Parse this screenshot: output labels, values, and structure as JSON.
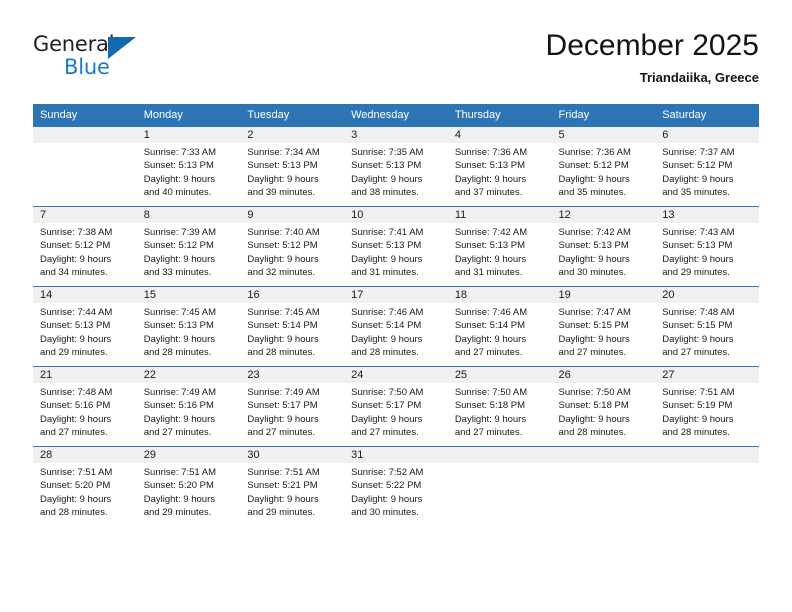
{
  "logo": {
    "primary_text": "General",
    "secondary_text": "Blue",
    "primary_color": "#231f20",
    "secondary_color": "#1e7bc4",
    "triangle_color": "#1469ae"
  },
  "header": {
    "title": "December 2025",
    "subtitle": "Triandaiika, Greece"
  },
  "theme": {
    "header_bg": "#2e75b6",
    "header_text": "#ffffff",
    "daynum_band_bg": "#f0f0f0",
    "row_border": "#2e75b6",
    "body_text": "#1a1a1a"
  },
  "weekday_headers": [
    "Sunday",
    "Monday",
    "Tuesday",
    "Wednesday",
    "Thursday",
    "Friday",
    "Saturday"
  ],
  "weeks": [
    [
      {
        "day": "",
        "lines": []
      },
      {
        "day": "1",
        "lines": [
          "Sunrise: 7:33 AM",
          "Sunset: 5:13 PM",
          "Daylight: 9 hours",
          "and 40 minutes."
        ]
      },
      {
        "day": "2",
        "lines": [
          "Sunrise: 7:34 AM",
          "Sunset: 5:13 PM",
          "Daylight: 9 hours",
          "and 39 minutes."
        ]
      },
      {
        "day": "3",
        "lines": [
          "Sunrise: 7:35 AM",
          "Sunset: 5:13 PM",
          "Daylight: 9 hours",
          "and 38 minutes."
        ]
      },
      {
        "day": "4",
        "lines": [
          "Sunrise: 7:36 AM",
          "Sunset: 5:13 PM",
          "Daylight: 9 hours",
          "and 37 minutes."
        ]
      },
      {
        "day": "5",
        "lines": [
          "Sunrise: 7:36 AM",
          "Sunset: 5:12 PM",
          "Daylight: 9 hours",
          "and 35 minutes."
        ]
      },
      {
        "day": "6",
        "lines": [
          "Sunrise: 7:37 AM",
          "Sunset: 5:12 PM",
          "Daylight: 9 hours",
          "and 35 minutes."
        ]
      }
    ],
    [
      {
        "day": "7",
        "lines": [
          "Sunrise: 7:38 AM",
          "Sunset: 5:12 PM",
          "Daylight: 9 hours",
          "and 34 minutes."
        ]
      },
      {
        "day": "8",
        "lines": [
          "Sunrise: 7:39 AM",
          "Sunset: 5:12 PM",
          "Daylight: 9 hours",
          "and 33 minutes."
        ]
      },
      {
        "day": "9",
        "lines": [
          "Sunrise: 7:40 AM",
          "Sunset: 5:12 PM",
          "Daylight: 9 hours",
          "and 32 minutes."
        ]
      },
      {
        "day": "10",
        "lines": [
          "Sunrise: 7:41 AM",
          "Sunset: 5:13 PM",
          "Daylight: 9 hours",
          "and 31 minutes."
        ]
      },
      {
        "day": "11",
        "lines": [
          "Sunrise: 7:42 AM",
          "Sunset: 5:13 PM",
          "Daylight: 9 hours",
          "and 31 minutes."
        ]
      },
      {
        "day": "12",
        "lines": [
          "Sunrise: 7:42 AM",
          "Sunset: 5:13 PM",
          "Daylight: 9 hours",
          "and 30 minutes."
        ]
      },
      {
        "day": "13",
        "lines": [
          "Sunrise: 7:43 AM",
          "Sunset: 5:13 PM",
          "Daylight: 9 hours",
          "and 29 minutes."
        ]
      }
    ],
    [
      {
        "day": "14",
        "lines": [
          "Sunrise: 7:44 AM",
          "Sunset: 5:13 PM",
          "Daylight: 9 hours",
          "and 29 minutes."
        ]
      },
      {
        "day": "15",
        "lines": [
          "Sunrise: 7:45 AM",
          "Sunset: 5:13 PM",
          "Daylight: 9 hours",
          "and 28 minutes."
        ]
      },
      {
        "day": "16",
        "lines": [
          "Sunrise: 7:45 AM",
          "Sunset: 5:14 PM",
          "Daylight: 9 hours",
          "and 28 minutes."
        ]
      },
      {
        "day": "17",
        "lines": [
          "Sunrise: 7:46 AM",
          "Sunset: 5:14 PM",
          "Daylight: 9 hours",
          "and 28 minutes."
        ]
      },
      {
        "day": "18",
        "lines": [
          "Sunrise: 7:46 AM",
          "Sunset: 5:14 PM",
          "Daylight: 9 hours",
          "and 27 minutes."
        ]
      },
      {
        "day": "19",
        "lines": [
          "Sunrise: 7:47 AM",
          "Sunset: 5:15 PM",
          "Daylight: 9 hours",
          "and 27 minutes."
        ]
      },
      {
        "day": "20",
        "lines": [
          "Sunrise: 7:48 AM",
          "Sunset: 5:15 PM",
          "Daylight: 9 hours",
          "and 27 minutes."
        ]
      }
    ],
    [
      {
        "day": "21",
        "lines": [
          "Sunrise: 7:48 AM",
          "Sunset: 5:16 PM",
          "Daylight: 9 hours",
          "and 27 minutes."
        ]
      },
      {
        "day": "22",
        "lines": [
          "Sunrise: 7:49 AM",
          "Sunset: 5:16 PM",
          "Daylight: 9 hours",
          "and 27 minutes."
        ]
      },
      {
        "day": "23",
        "lines": [
          "Sunrise: 7:49 AM",
          "Sunset: 5:17 PM",
          "Daylight: 9 hours",
          "and 27 minutes."
        ]
      },
      {
        "day": "24",
        "lines": [
          "Sunrise: 7:50 AM",
          "Sunset: 5:17 PM",
          "Daylight: 9 hours",
          "and 27 minutes."
        ]
      },
      {
        "day": "25",
        "lines": [
          "Sunrise: 7:50 AM",
          "Sunset: 5:18 PM",
          "Daylight: 9 hours",
          "and 27 minutes."
        ]
      },
      {
        "day": "26",
        "lines": [
          "Sunrise: 7:50 AM",
          "Sunset: 5:18 PM",
          "Daylight: 9 hours",
          "and 28 minutes."
        ]
      },
      {
        "day": "27",
        "lines": [
          "Sunrise: 7:51 AM",
          "Sunset: 5:19 PM",
          "Daylight: 9 hours",
          "and 28 minutes."
        ]
      }
    ],
    [
      {
        "day": "28",
        "lines": [
          "Sunrise: 7:51 AM",
          "Sunset: 5:20 PM",
          "Daylight: 9 hours",
          "and 28 minutes."
        ]
      },
      {
        "day": "29",
        "lines": [
          "Sunrise: 7:51 AM",
          "Sunset: 5:20 PM",
          "Daylight: 9 hours",
          "and 29 minutes."
        ]
      },
      {
        "day": "30",
        "lines": [
          "Sunrise: 7:51 AM",
          "Sunset: 5:21 PM",
          "Daylight: 9 hours",
          "and 29 minutes."
        ]
      },
      {
        "day": "31",
        "lines": [
          "Sunrise: 7:52 AM",
          "Sunset: 5:22 PM",
          "Daylight: 9 hours",
          "and 30 minutes."
        ]
      },
      {
        "day": "",
        "lines": []
      },
      {
        "day": "",
        "lines": []
      },
      {
        "day": "",
        "lines": []
      }
    ]
  ]
}
